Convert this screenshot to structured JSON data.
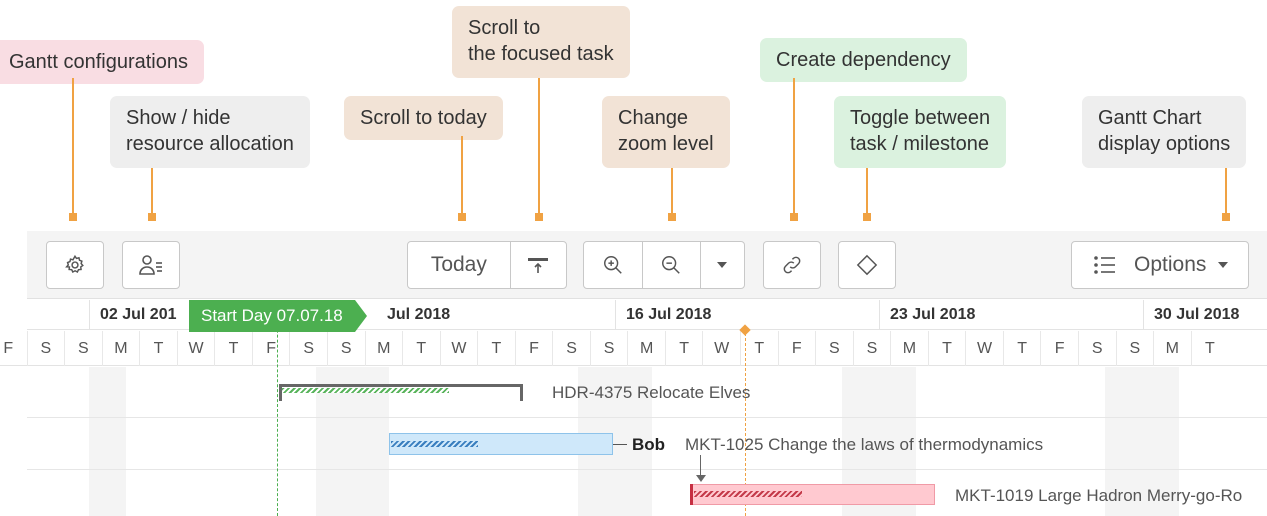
{
  "callouts": {
    "gantt_config": "Gantt configurations",
    "resource_line1": "Show / hide",
    "resource_line2": "resource allocation",
    "scroll_today": "Scroll to today",
    "scroll_focus_line1": "Scroll to",
    "scroll_focus_line2": "the focused task",
    "zoom_line1": "Change",
    "zoom_line2": "zoom level",
    "dependency": "Create dependency",
    "toggle_line1": "Toggle between",
    "toggle_line2": "task / milestone",
    "display_line1": "Gantt Chart",
    "display_line2": "display options"
  },
  "toolbar": {
    "today_label": "Today",
    "options_label": "Options"
  },
  "timeline": {
    "weeks": [
      "02 Jul 201",
      "Jul 2018",
      "16 Jul 2018",
      "23 Jul 2018",
      "30 Jul 2018"
    ],
    "days": [
      "F",
      "S",
      "S",
      "M",
      "T",
      "W",
      "T",
      "F",
      "S",
      "S",
      "M",
      "T",
      "W",
      "T",
      "F",
      "S",
      "S",
      "M",
      "T",
      "W",
      "T",
      "F",
      "S",
      "S",
      "M",
      "T",
      "W",
      "T",
      "F",
      "S",
      "S",
      "M",
      "T"
    ],
    "start_marker": "Start Day 07.07.18"
  },
  "tasks": [
    {
      "label": "HDR-4375 Relocate Elves",
      "progress": 0.7
    },
    {
      "assignee": "Bob",
      "label": "MKT-1025 Change the laws of thermodynamics",
      "progress": 0.4
    },
    {
      "label": "MKT-1019 Large Hadron Merry-go-Ro",
      "progress": 0.45
    }
  ],
  "colors": {
    "accent_orange": "#f0a243",
    "start_green": "#4caf50",
    "task_blue": "#cfe8fa",
    "task_red": "#ffc9d0"
  }
}
